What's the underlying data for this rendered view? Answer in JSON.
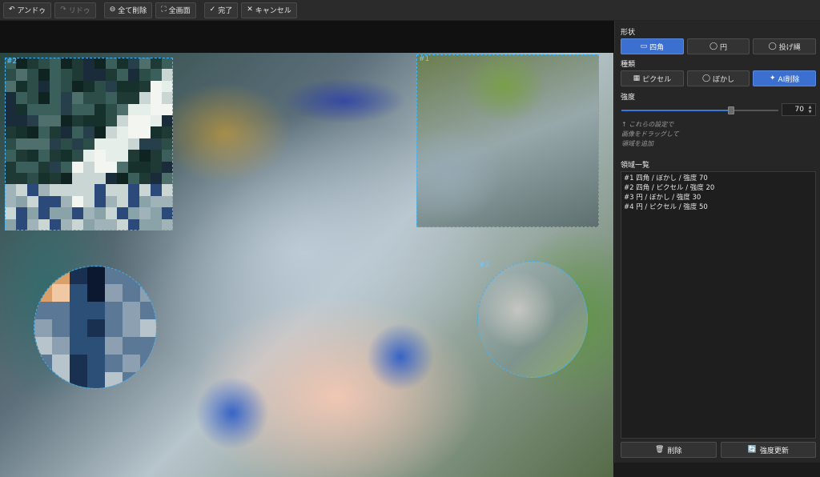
{
  "toolbar": {
    "undo": {
      "icon": "↶",
      "label": "アンドゥ"
    },
    "redo": {
      "icon": "↷",
      "label": "リドゥ"
    },
    "delete_all": {
      "icon": "⊖",
      "label": "全て削除"
    },
    "fullscreen": {
      "icon": "⛶",
      "label": "全画面"
    },
    "done": {
      "icon": "✓",
      "label": "完了"
    },
    "cancel": {
      "icon": "✕",
      "label": "キャンセル"
    }
  },
  "canvas": {
    "regions": [
      {
        "id": "#1",
        "shape": "rect",
        "effect": "blur"
      },
      {
        "id": "#2",
        "shape": "rect",
        "effect": "pixelate"
      },
      {
        "id": "#3",
        "shape": "circle",
        "effect": "blur"
      },
      {
        "id": "#4",
        "shape": "circle",
        "effect": "pixelate"
      }
    ]
  },
  "panel": {
    "shape_title": "形状",
    "shape_options": [
      {
        "icon": "▭",
        "label": "四角",
        "active": true
      },
      {
        "icon": "◯",
        "label": "円",
        "active": false
      },
      {
        "icon": "◯",
        "label": "投げ縄",
        "active": false
      }
    ],
    "type_title": "種類",
    "type_options": [
      {
        "icon": "▦",
        "label": "ピクセル",
        "active": false
      },
      {
        "icon": "◯",
        "label": "ぼかし",
        "active": false
      },
      {
        "icon": "✦",
        "label": "AI削除",
        "active": true
      }
    ],
    "strength_title": "強度",
    "strength_value": "70",
    "strength_fraction": 0.7,
    "hint_lines": [
      "↑ これらの設定で",
      "画像をドラッグして",
      "領域を追加"
    ],
    "list_title": "領域一覧",
    "list_items": [
      "#1 四角 / ぼかし / 強度 70",
      "#2 四角 / ピクセル / 強度 20",
      "#3 円 / ぼかし / 強度 30",
      "#4 円 / ピクセル / 強度 50"
    ],
    "delete_button": {
      "icon": "🗑",
      "label": "削除"
    },
    "update_button": {
      "icon": "🔄",
      "label": "強度更新"
    }
  },
  "colors": {
    "accent": "#3b6fd0",
    "selection": "#3cb6ff"
  }
}
